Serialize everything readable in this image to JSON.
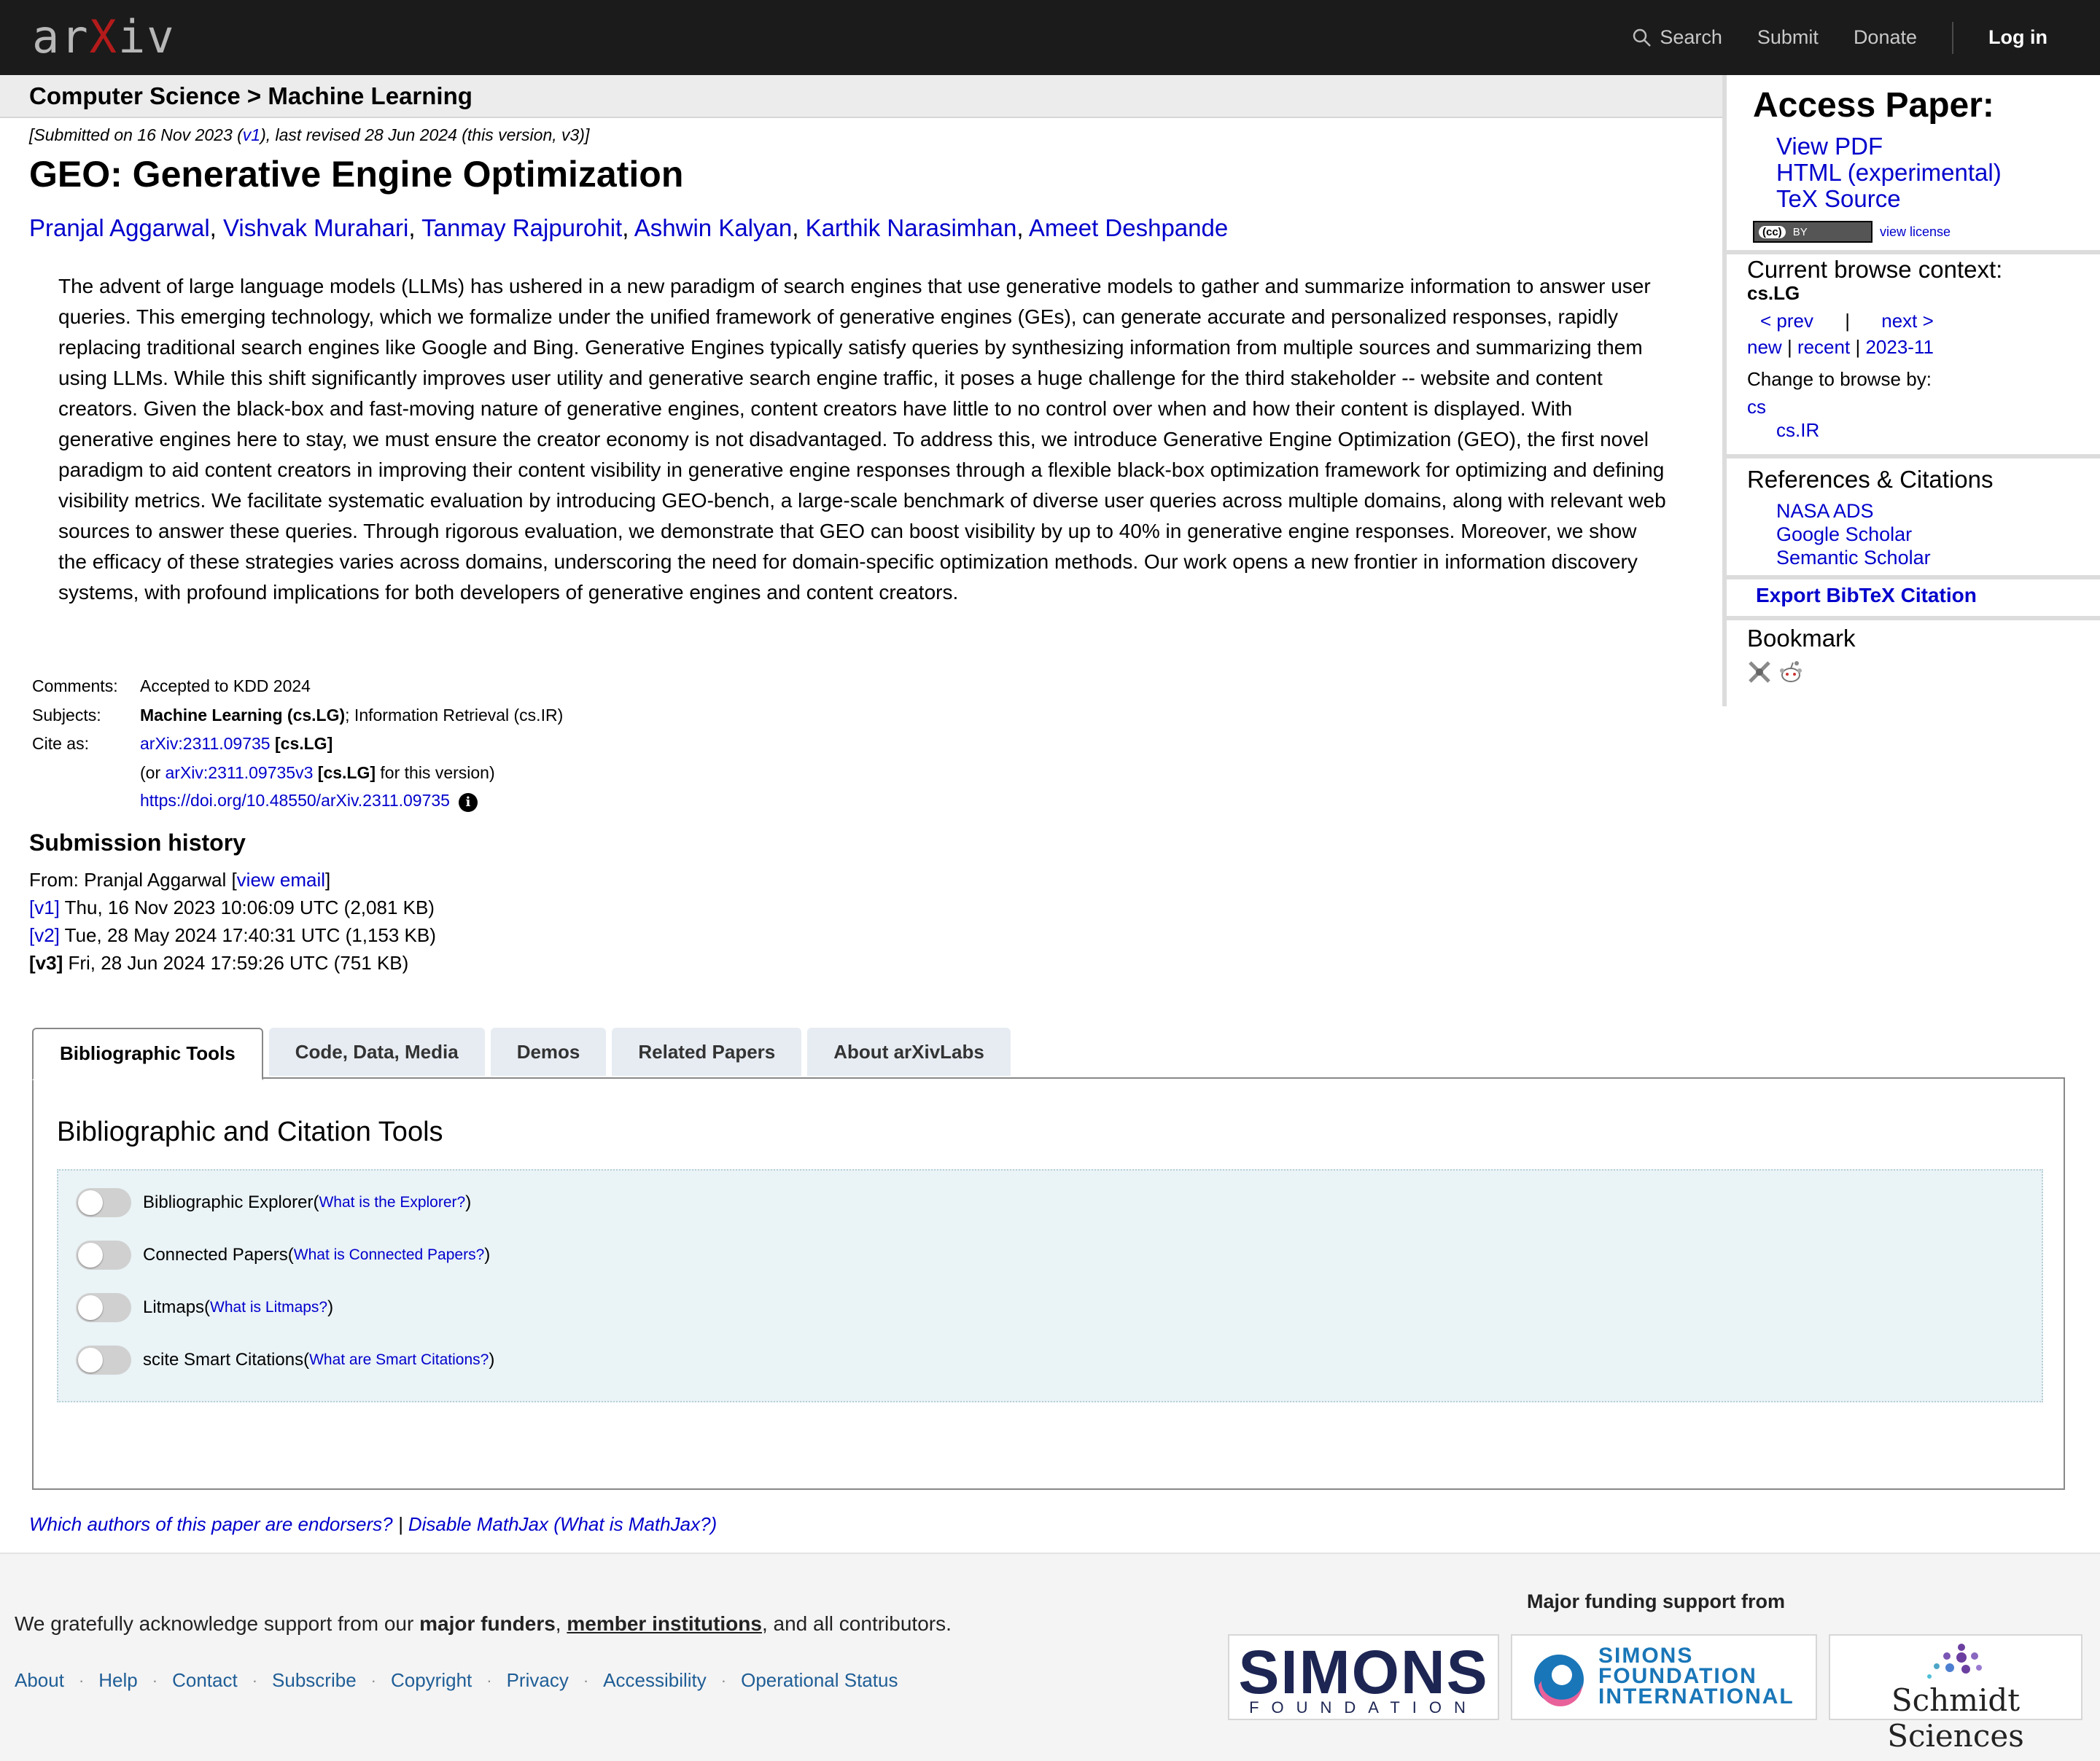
{
  "topbar": {
    "logo": {
      "pre": "ar",
      "x": "X",
      "post": "iv"
    },
    "search_label": "Search",
    "submit_label": "Submit",
    "donate_label": "Donate",
    "login_label": "Log in"
  },
  "breadcrumb": "Computer Science > Machine Learning",
  "dateline": {
    "part1": "[Submitted on 16 Nov 2023 (",
    "v1": "v1",
    "part2": "), last revised 28 Jun 2024 (this version, v3)]"
  },
  "title": "GEO: Generative Engine Optimization",
  "authors": [
    "Pranjal Aggarwal",
    "Vishvak Murahari",
    "Tanmay Rajpurohit",
    "Ashwin Kalyan",
    "Karthik Narasimhan",
    "Ameet Deshpande"
  ],
  "author_sep": ", ",
  "abstract": "The advent of large language models (LLMs) has ushered in a new paradigm of search engines that use generative models to gather and summarize information to answer user queries. This emerging technology, which we formalize under the unified framework of generative engines (GEs), can generate accurate and personalized responses, rapidly replacing traditional search engines like Google and Bing. Generative Engines typically satisfy queries by synthesizing information from multiple sources and summarizing them using LLMs. While this shift significantly improves user utility and generative search engine traffic, it poses a huge challenge for the third stakeholder -- website and content creators. Given the black-box and fast-moving nature of generative engines, content creators have little to no control over when and how their content is displayed. With generative engines here to stay, we must ensure the creator economy is not disadvantaged. To address this, we introduce Generative Engine Optimization (GEO), the first novel paradigm to aid content creators in improving their content visibility in generative engine responses through a flexible black-box optimization framework for optimizing and defining visibility metrics. We facilitate systematic evaluation by introducing GEO-bench, a large-scale benchmark of diverse user queries across multiple domains, along with relevant web sources to answer these queries. Through rigorous evaluation, we demonstrate that GEO can boost visibility by up to 40% in generative engine responses. Moreover, we show the efficacy of these strategies varies across domains, underscoring the need for domain-specific optimization methods. Our work opens a new frontier in information discovery systems, with profound implications for both developers of generative engines and content creators.",
  "meta": {
    "comments_label": "Comments:",
    "comments": "Accepted to KDD 2024",
    "subjects_label": "Subjects:",
    "subject_primary": "Machine Learning (cs.LG)",
    "subject_rest": "; Information Retrieval (cs.IR)",
    "cite_label": "Cite as:",
    "cite_id": "arXiv:2311.09735",
    "cite_cat": " [cs.LG]",
    "cite_or": "(or ",
    "cite_id_v": "arXiv:2311.09735v3",
    "cite_cat_v": " [cs.LG]",
    "cite_for": " for this version)",
    "doi": "https://doi.org/10.48550/arXiv.2311.09735",
    "info_glyph": "i"
  },
  "submission": {
    "title": "Submission history",
    "from_label": "From: Pranjal Aggarwal [",
    "view_email": "view email",
    "from_close": "]",
    "versions": [
      {
        "label": "[v1]",
        "text": " Thu, 16 Nov 2023 10:06:09 UTC (2,081 KB)"
      },
      {
        "label": "[v2]",
        "text": " Tue, 28 May 2024 17:40:31 UTC (1,153 KB)"
      },
      {
        "label": "[v3]",
        "text": " Fri, 28 Jun 2024 17:59:26 UTC (751 KB)"
      }
    ]
  },
  "tabs": [
    "Bibliographic Tools",
    "Code, Data, Media",
    "Demos",
    "Related Papers",
    "About arXivLabs"
  ],
  "tabpanel": {
    "heading": "Bibliographic and Citation Tools",
    "tools": [
      {
        "name": "Bibliographic Explorer",
        "help": "What is the Explorer?",
        "enabled": false
      },
      {
        "name": "Connected Papers",
        "help": "What is Connected Papers?",
        "enabled": false
      },
      {
        "name": "Litmaps",
        "help": "What is Litmaps?",
        "enabled": false
      },
      {
        "name": "scite Smart Citations",
        "help": "What are Smart Citations?",
        "enabled": false
      }
    ],
    "open_paren": " (",
    "close_paren": ")"
  },
  "endorse": {
    "endorsers": "Which authors of this paper are endorsers?",
    "sep": " | ",
    "disable": "Disable MathJax",
    "what": " (What is MathJax?)"
  },
  "sidebar": {
    "access_title": "Access Paper:",
    "access_links": [
      "View PDF",
      "HTML (experimental)",
      "TeX Source"
    ],
    "cc_label": "(cc)",
    "cc_by": "BY",
    "view_license": "view license",
    "browse_title": "Current browse context:",
    "browse_cat": "cs.LG",
    "prev": "< prev",
    "pipe": "|",
    "next": "next >",
    "new": "new",
    "recent": "recent",
    "month": "2023-11",
    "change_label": "Change to browse by:",
    "cs": "cs",
    "csir": "cs.IR",
    "refs_title": "References & Citations",
    "refs_links": [
      "NASA ADS",
      "Google Scholar",
      "Semantic Scholar"
    ],
    "export": "Export BibTeX Citation",
    "bookmark": "Bookmark"
  },
  "footer": {
    "ack_pre": "We gratefully acknowledge support from our ",
    "major_funders": "major funders",
    "comma": ", ",
    "member_institutions": "member institutions",
    "ack_post": ", and all contributors.",
    "links": [
      "About",
      "Help",
      "Contact",
      "Subscribe",
      "Copyright",
      "Privacy",
      "Accessibility",
      "Operational Status"
    ],
    "dot": "·",
    "funding_title": "Major funding support from",
    "simons_big": "SIMONS",
    "simons_small": "FOUNDATION",
    "sfi_lines": [
      "SIMONS",
      "FOUNDATION",
      "INTERNATIONAL"
    ],
    "schmidt": "Schmidt Sciences"
  },
  "colors": {
    "topbar": "#1b1b1b",
    "link": "#0000cc",
    "simons_navy": "#1d2553",
    "sfi_blue": "#1976b8",
    "schmidt_purple": "#6b3fa0"
  }
}
